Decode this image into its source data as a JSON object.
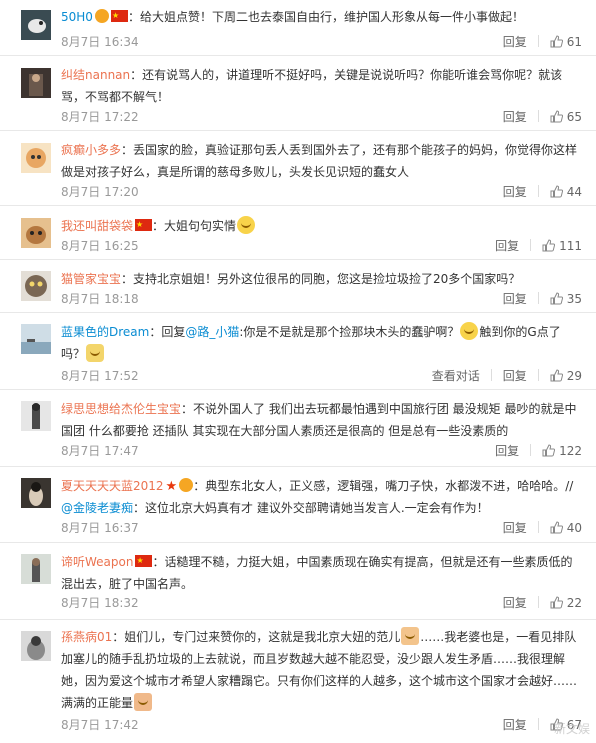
{
  "reply_label": "回复",
  "view_dialog_label": "查看对话",
  "watermark_text": "新文娱",
  "colors": {
    "username_orange": "#eb7350",
    "username_blue": "#0a8cd2",
    "meta_gray": "#999999",
    "divider": "#e8e8e8"
  },
  "comments": [
    {
      "username": "50H0",
      "badges": [
        "vip-badge-icon",
        "china-flag-icon"
      ],
      "text": "：给大姐点赞！下周二也去泰国自由行，维护国人形象从每一件小事做起！",
      "time": "8月7日 16:34",
      "likes": "61"
    },
    {
      "username": "纠结nannan",
      "text": "：还有说骂人的，讲道理听不挺好吗，关键是说说听吗？你能听谁会骂你呢？就该骂，不骂都不解气！",
      "time": "8月7日 17:22",
      "likes": "65"
    },
    {
      "username": "疯癫小多多",
      "text": "：丢国家的脸，真验证那句丢人丢到国外去了，还有那个能孩子的妈妈，你觉得你这样做是对孩子好么，真是所谓的慈母多败儿，头发长见识短的蠢女人",
      "time": "8月7日 17:20",
      "likes": "44"
    },
    {
      "username": "我还叫甜袋袋",
      "badges": [
        "china-flag-icon"
      ],
      "text": "：大姐句句实情",
      "time": "8月7日 16:25",
      "likes": "111"
    },
    {
      "username": "猫管家宝宝",
      "text": "：支持北京姐姐！另外这位很吊的同胞，您这是捡垃圾捡了20多个国家吗？",
      "time": "8月7日 18:18",
      "likes": "35"
    },
    {
      "username": "蓝果色的Dream",
      "text_before": "：回复",
      "mention": "@路_小猫",
      "text_after": ":你是不是就是那个捡那块木头的蠢驴啊？",
      "text_after2": "触到你的G点了吗？",
      "time": "8月7日 17:52",
      "likes": "29"
    },
    {
      "username": "绿思思想给杰伦生宝宝",
      "text": "：不说外国人了 我们出去玩都最怕遇到中国旅行团 最没规矩 最吵的就是中国团 什么都要抢 还插队 其实现在大部分国人素质还是很高的 但是总有一些没素质的",
      "time": "8月7日 17:47",
      "likes": "122"
    },
    {
      "username": "夏天天天天蓝2012",
      "badges": [
        "star-badge-icon",
        "vip-badge-icon"
      ],
      "text_before": "：典型东北女人，正义感，逻辑强，嘴刀子快，水都泼不进，哈哈哈。//",
      "mention": "@金陵老妻痴",
      "text_after": "：这位北京大妈真有才 建议外交部聘请她当发言人.一定会有作为！",
      "time": "8月7日 16:37",
      "likes": "40"
    },
    {
      "username": "谛听Weapon",
      "badges": [
        "china-flag-icon"
      ],
      "text": "：话糙理不糙，力挺大姐，中国素质现在确实有提高，但就是还有一些素质低的混出去，脏了中国名声。",
      "time": "8月7日 18:32",
      "likes": "22"
    },
    {
      "username": "孫燕病01",
      "text_before": "：姐们儿，专门过来赞你的，这就是我北京大妞的范儿",
      "text_after": "……我老婆也是，一看见排队加塞儿的随手乱扔垃圾的上去就说，而且岁数越大越不能忍受，没少跟人发生矛盾……我很理解她，因为爱这个城市才希望人家糟蹋它。只有你们这样的人越多，这个城市这个国家才会越好……满满的正能量",
      "time": "8月7日 17:42",
      "likes": "67"
    }
  ]
}
